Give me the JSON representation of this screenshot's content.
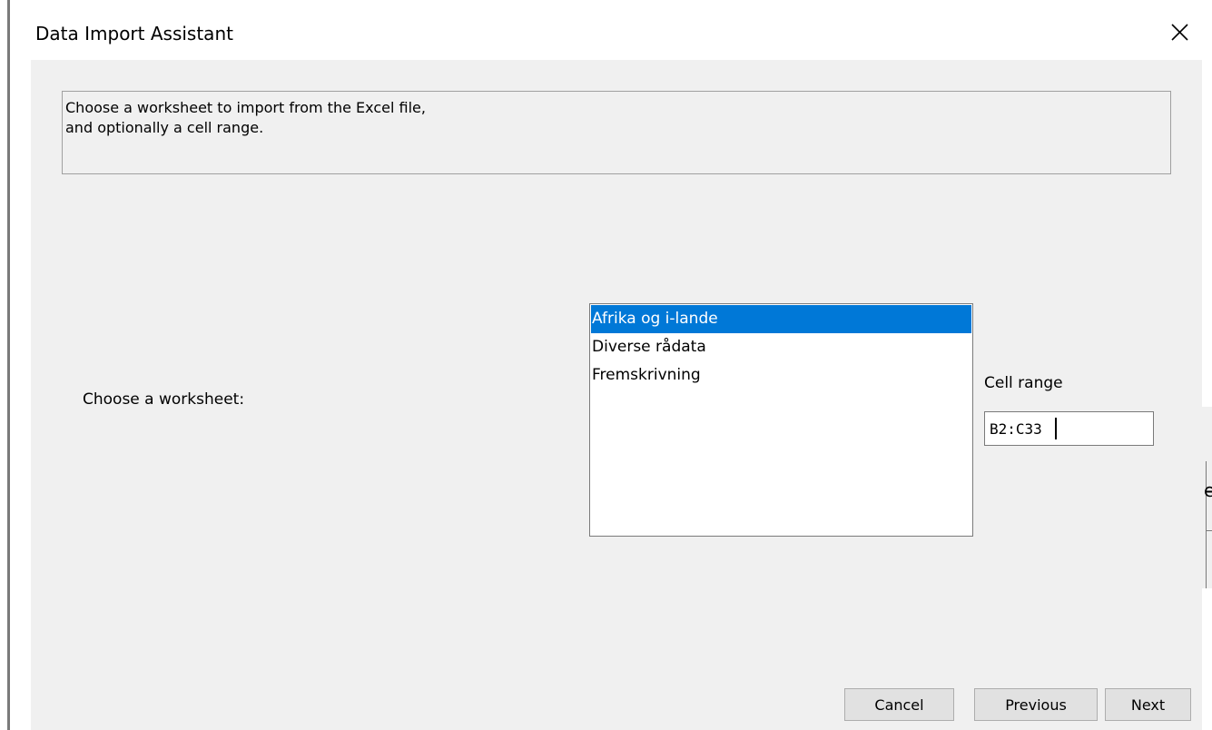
{
  "dialog": {
    "title": "Data Import Assistant",
    "instructions": [
      "Choose a worksheet to import from the Excel file,",
      "and optionally a cell range."
    ],
    "worksheet_label": "Choose a worksheet:",
    "worksheets": [
      {
        "label": "Afrika og i-lande",
        "selected": true
      },
      {
        "label": "Diverse rådata",
        "selected": false
      },
      {
        "label": "Fremskrivning",
        "selected": false
      }
    ],
    "cell_range": {
      "label": "Cell range",
      "value": "B2:C33"
    },
    "buttons": {
      "cancel": "Cancel",
      "previous": "Previous",
      "next": "Next"
    }
  },
  "background_fragment": {
    "glyph": "e"
  },
  "icons": {
    "close": "close-icon"
  },
  "colors": {
    "selection": "#0078d7",
    "dialog_bg": "#f0f0f0"
  }
}
